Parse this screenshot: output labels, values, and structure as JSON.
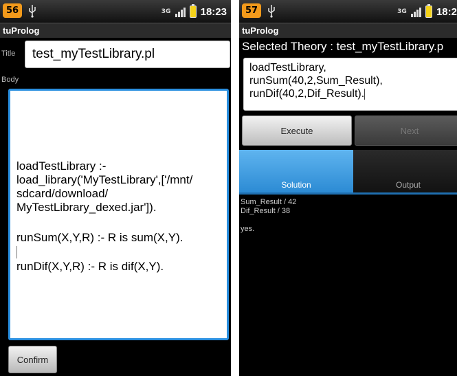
{
  "left_screen": {
    "status": {
      "notification_count": "56",
      "time": "18:23",
      "network": "3G"
    },
    "app_title": "tuProlog",
    "title_label": "Title",
    "title_value": "test_myTestLibrary.pl",
    "body_label": "Body",
    "body_paragraphs": [
      "loadTestLibrary :- load_library('MyTestLibrary',['/mnt/ sdcard/download/ MyTestLibrary_dexed.jar']).",
      "runSum(X,Y,R) :- R is sum(X,Y).",
      "runDif(X,Y,R) :- R is dif(X,Y)."
    ],
    "confirm_label": "Confirm"
  },
  "right_screen": {
    "status": {
      "notification_count": "57",
      "time": "18:2",
      "network": "3G"
    },
    "app_title": "tuProlog",
    "selected_theory": "Selected Theory : test_myTestLibrary.p",
    "query_lines": [
      "loadTestLibrary,",
      "runSum(40,2,Sum_Result),",
      "runDif(40,2,Dif_Result)."
    ],
    "execute_label": "Execute",
    "next_label": "Next",
    "tabs": [
      {
        "label": "Solution",
        "active": true
      },
      {
        "label": "Output",
        "active": false
      }
    ],
    "results": [
      "Sum_Result / 42",
      "Dif_Result / 38",
      "yes."
    ]
  },
  "colors": {
    "accent_blue": "#2a8fe0",
    "notification_orange": "#f39a1b",
    "battery_yellow": "#f5d31a"
  }
}
